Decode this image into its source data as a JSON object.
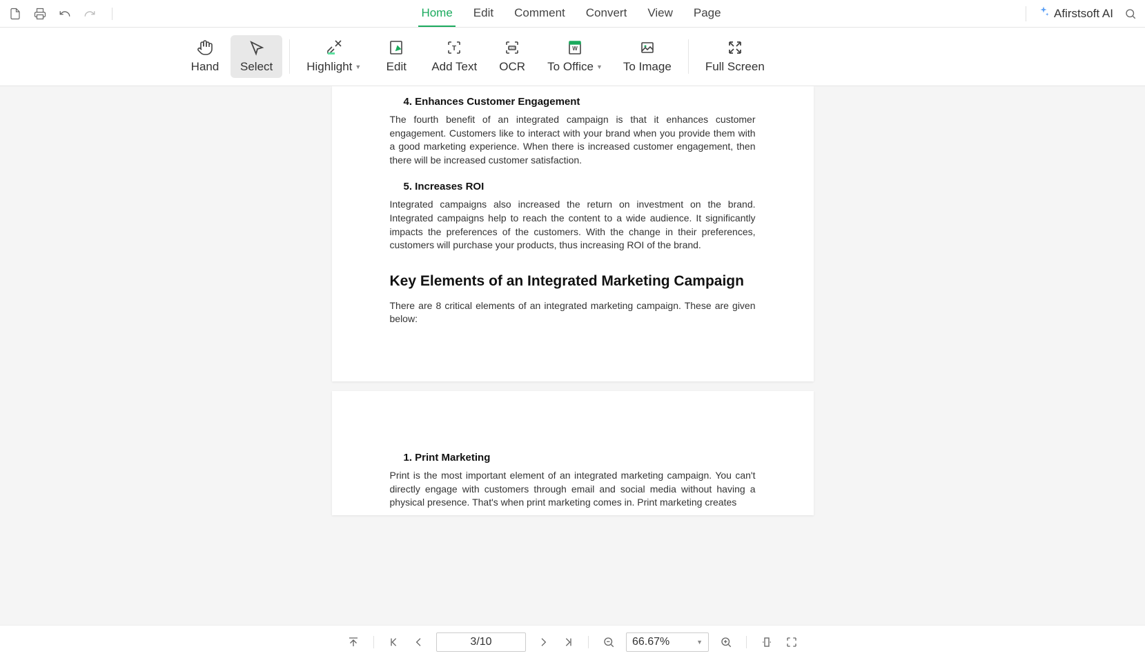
{
  "tabs": {
    "home": "Home",
    "edit": "Edit",
    "comment": "Comment",
    "convert": "Convert",
    "view": "View",
    "page": "Page"
  },
  "ai_label": "Afirstsoft AI",
  "ribbon": {
    "hand": "Hand",
    "select": "Select",
    "highlight": "Highlight",
    "edit": "Edit",
    "add_text": "Add Text",
    "ocr": "OCR",
    "to_office": "To Office",
    "to_image": "To Image",
    "full_screen": "Full Screen"
  },
  "document": {
    "section4_title": "4.  Enhances Customer Engagement",
    "section4_body": "The fourth benefit of an integrated campaign is that it enhances customer engagement. Customers like to interact with your brand when you provide them with a good marketing experience. When there is increased customer engagement, then there will be increased customer satisfaction.",
    "section5_title": "5.  Increases ROI",
    "section5_body": "Integrated campaigns also increased the return on investment on the brand. Integrated campaigns help to reach the content to a wide audience. It significantly impacts the preferences of the customers.  With the change in their preferences, customers will purchase your products, thus increasing ROI of the brand.",
    "h2": "Key Elements of an Integrated Marketing Campaign",
    "intro": "There are 8 critical elements of an integrated marketing campaign. These are given below:",
    "section_pm_title": "1.  Print Marketing",
    "section_pm_body": "Print is the most important element of an integrated marketing campaign. You can't directly engage with customers through email and social media without having a physical presence. That's when print marketing comes in. Print marketing creates"
  },
  "bottom": {
    "page_indicator": "3/10",
    "zoom": "66.67%"
  }
}
